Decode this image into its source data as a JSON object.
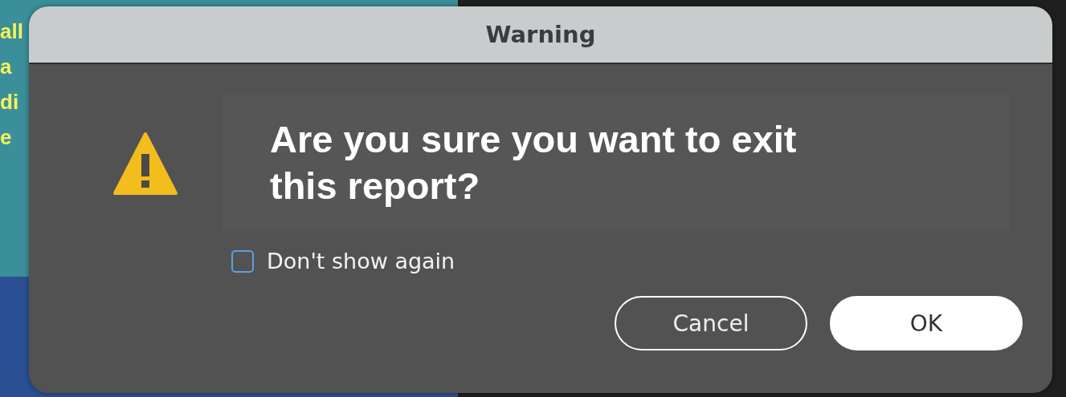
{
  "background": {
    "text_lines": [
      "all",
      "a",
      "di",
      "e"
    ]
  },
  "dialog": {
    "title": "Warning",
    "message": "Are you sure you want to exit this report?",
    "checkbox": {
      "label": "Don't show again",
      "checked": false
    },
    "buttons": [
      {
        "label": "Cancel",
        "kind": "secondary"
      },
      {
        "label": "OK",
        "kind": "primary"
      }
    ]
  }
}
